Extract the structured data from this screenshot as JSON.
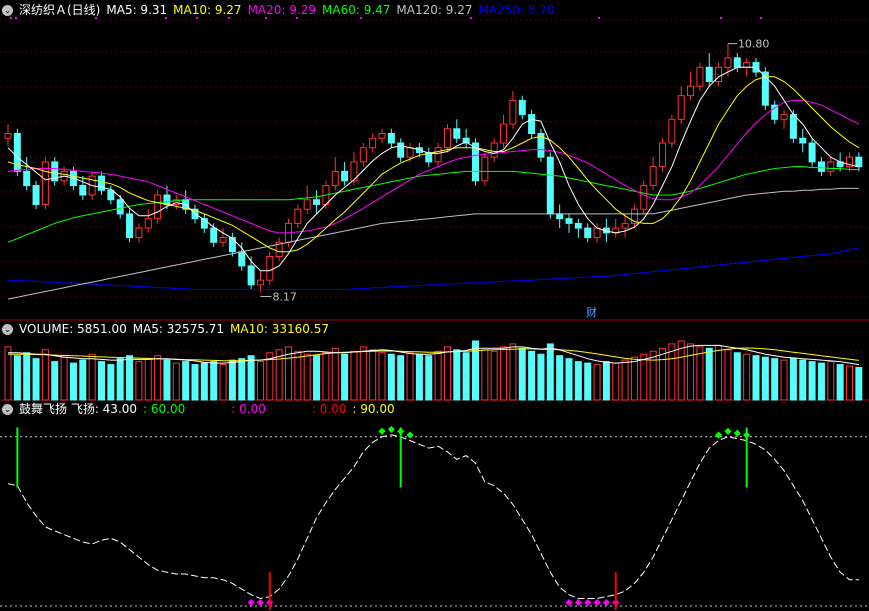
{
  "panels": {
    "price": {
      "title": "深纺织Ａ(日线)",
      "indicators": [
        {
          "label": "MA5: 9.31",
          "color": "#ffffff"
        },
        {
          "label": "MA10: 9.27",
          "color": "#ffff00"
        },
        {
          "label": "MA20: 9.29",
          "color": "#ff00ff"
        },
        {
          "label": "MA60: 9.47",
          "color": "#00ff00"
        },
        {
          "label": "MA120: 9.27",
          "color": "#c0c0c0"
        },
        {
          "label": "MA250: 8.70",
          "color": "#0000ff"
        }
      ],
      "high_label": "10.80",
      "low_label": "8.17",
      "marker": "财"
    },
    "volume": {
      "indicators": [
        {
          "label": "VOLUME: 5851.00",
          "color": "#ffffff"
        },
        {
          "label": "MA5: 32575.71",
          "color": "#ffffff"
        },
        {
          "label": "MA10: 33160.57",
          "color": "#ffff00"
        }
      ]
    },
    "oscillator": {
      "indicators": [
        {
          "label": "鼓舞飞扬  飞扬: 43.00",
          "color": "#ffffff"
        },
        {
          "label": ": 60.00",
          "color": "#00ff00"
        },
        {
          "label": ": 0.00",
          "color": "#ff00ff"
        },
        {
          "label": ": 0.00",
          "color": "#ff0000"
        },
        {
          "label": ": 90.00",
          "color": "#ffff00"
        }
      ]
    }
  },
  "colors": {
    "up": "#ff3232",
    "down": "#54fcfc",
    "ma5": "#ffffff",
    "ma10": "#ffff00",
    "ma20": "#ff00ff",
    "ma60": "#00ff00",
    "ma120": "#c0c0c0",
    "ma250": "#0000ff",
    "separator": "#aa0000"
  },
  "chart_data": {
    "type": "candlestick",
    "candles": [
      [
        9.8,
        9.85,
        9.72,
        9.95
      ],
      [
        9.85,
        9.45,
        9.4,
        9.9
      ],
      [
        9.45,
        9.3,
        9.25,
        9.6
      ],
      [
        9.3,
        9.1,
        9.05,
        9.35
      ],
      [
        9.1,
        9.55,
        9.05,
        9.6
      ],
      [
        9.55,
        9.35,
        9.3,
        9.6
      ],
      [
        9.35,
        9.45,
        9.3,
        9.5
      ],
      [
        9.45,
        9.3,
        9.25,
        9.5
      ],
      [
        9.3,
        9.2,
        9.15,
        9.4
      ],
      [
        9.2,
        9.4,
        9.15,
        9.45
      ],
      [
        9.4,
        9.25,
        9.2,
        9.45
      ],
      [
        9.25,
        9.15,
        9.1,
        9.3
      ],
      [
        9.15,
        9.0,
        8.95,
        9.2
      ],
      [
        9.0,
        8.75,
        8.7,
        9.05
      ],
      [
        8.75,
        8.85,
        8.7,
        8.9
      ],
      [
        8.85,
        8.95,
        8.8,
        9.05
      ],
      [
        8.95,
        9.2,
        8.9,
        9.25
      ],
      [
        9.2,
        9.1,
        9.05,
        9.3
      ],
      [
        9.1,
        9.15,
        9.05,
        9.2
      ],
      [
        9.15,
        9.05,
        9.0,
        9.25
      ],
      [
        9.05,
        8.95,
        8.9,
        9.1
      ],
      [
        8.95,
        8.85,
        8.8,
        9.0
      ],
      [
        8.85,
        8.7,
        8.65,
        8.9
      ],
      [
        8.7,
        8.75,
        8.65,
        8.85
      ],
      [
        8.75,
        8.6,
        8.55,
        8.8
      ],
      [
        8.6,
        8.45,
        8.4,
        8.7
      ],
      [
        8.45,
        8.25,
        8.2,
        8.55
      ],
      [
        8.25,
        8.3,
        8.17,
        8.4
      ],
      [
        8.3,
        8.55,
        8.25,
        8.6
      ],
      [
        8.55,
        8.7,
        8.5,
        8.75
      ],
      [
        8.7,
        8.9,
        8.65,
        8.95
      ],
      [
        8.9,
        9.05,
        8.85,
        9.1
      ],
      [
        9.05,
        9.15,
        9.0,
        9.3
      ],
      [
        9.15,
        9.1,
        9.0,
        9.25
      ],
      [
        9.1,
        9.3,
        9.05,
        9.35
      ],
      [
        9.3,
        9.45,
        9.25,
        9.6
      ],
      [
        9.45,
        9.35,
        9.3,
        9.55
      ],
      [
        9.35,
        9.55,
        9.3,
        9.65
      ],
      [
        9.55,
        9.7,
        9.5,
        9.75
      ],
      [
        9.7,
        9.8,
        9.65,
        9.85
      ],
      [
        9.8,
        9.85,
        9.75,
        9.9
      ],
      [
        9.85,
        9.75,
        9.7,
        9.9
      ],
      [
        9.75,
        9.6,
        9.55,
        9.8
      ],
      [
        9.6,
        9.7,
        9.55,
        9.75
      ],
      [
        9.7,
        9.65,
        9.6,
        9.75
      ],
      [
        9.65,
        9.55,
        9.5,
        9.7
      ],
      [
        9.55,
        9.7,
        9.5,
        9.75
      ],
      [
        9.7,
        9.9,
        9.65,
        9.95
      ],
      [
        9.9,
        9.8,
        9.75,
        10.0
      ],
      [
        9.8,
        9.75,
        9.7,
        9.9
      ],
      [
        9.75,
        9.35,
        9.3,
        9.8
      ],
      [
        9.35,
        9.6,
        9.3,
        9.65
      ],
      [
        9.6,
        9.75,
        9.55,
        9.8
      ],
      [
        9.75,
        9.95,
        9.7,
        10.05
      ],
      [
        9.95,
        10.2,
        9.9,
        10.3
      ],
      [
        10.2,
        10.05,
        10.0,
        10.25
      ],
      [
        10.05,
        9.85,
        9.8,
        10.1
      ],
      [
        9.85,
        9.6,
        9.55,
        9.9
      ],
      [
        9.6,
        9.0,
        8.95,
        9.65
      ],
      [
        9.0,
        8.95,
        8.85,
        9.1
      ],
      [
        8.95,
        8.9,
        8.8,
        9.0
      ],
      [
        8.9,
        8.85,
        8.75,
        8.95
      ],
      [
        8.85,
        8.75,
        8.7,
        8.9
      ],
      [
        8.75,
        8.85,
        8.7,
        8.9
      ],
      [
        8.85,
        8.8,
        8.7,
        8.95
      ],
      [
        8.8,
        8.85,
        8.75,
        8.95
      ],
      [
        8.85,
        8.9,
        8.75,
        9.0
      ],
      [
        8.9,
        9.05,
        8.85,
        9.1
      ],
      [
        9.05,
        9.3,
        9.0,
        9.35
      ],
      [
        9.3,
        9.5,
        9.25,
        9.6
      ],
      [
        9.5,
        9.75,
        9.45,
        9.8
      ],
      [
        9.75,
        10.0,
        9.7,
        10.05
      ],
      [
        10.0,
        10.25,
        9.95,
        10.35
      ],
      [
        10.25,
        10.35,
        10.2,
        10.5
      ],
      [
        10.35,
        10.55,
        10.3,
        10.6
      ],
      [
        10.55,
        10.4,
        10.35,
        10.7
      ],
      [
        10.4,
        10.55,
        10.35,
        10.6
      ],
      [
        10.55,
        10.65,
        10.45,
        10.8
      ],
      [
        10.65,
        10.55,
        10.5,
        10.7
      ],
      [
        10.55,
        10.6,
        10.45,
        10.65
      ],
      [
        10.6,
        10.5,
        10.45,
        10.65
      ],
      [
        10.5,
        10.15,
        10.1,
        10.55
      ],
      [
        10.15,
        10.0,
        9.95,
        10.2
      ],
      [
        10.0,
        10.05,
        9.9,
        10.1
      ],
      [
        10.05,
        9.8,
        9.75,
        10.1
      ],
      [
        9.8,
        9.75,
        9.65,
        9.9
      ],
      [
        9.75,
        9.55,
        9.5,
        9.8
      ],
      [
        9.55,
        9.45,
        9.4,
        9.6
      ],
      [
        9.45,
        9.55,
        9.4,
        9.6
      ],
      [
        9.55,
        9.5,
        9.45,
        9.65
      ],
      [
        9.5,
        9.6,
        9.45,
        9.65
      ],
      [
        9.6,
        9.5,
        9.45,
        9.65
      ]
    ],
    "ma5": [
      9.7,
      9.6,
      9.52,
      9.44,
      9.36,
      9.38,
      9.4,
      9.38,
      9.34,
      9.3,
      9.28,
      9.26,
      9.18,
      9.06,
      8.98,
      8.98,
      9.02,
      9.08,
      9.12,
      9.1,
      9.0,
      8.94,
      8.86,
      8.8,
      8.74,
      8.64,
      8.5,
      8.4,
      8.4,
      8.45,
      8.58,
      8.74,
      8.9,
      9.0,
      9.1,
      9.2,
      9.28,
      9.36,
      9.46,
      9.56,
      9.64,
      9.7,
      9.72,
      9.7,
      9.68,
      9.64,
      9.64,
      9.66,
      9.72,
      9.76,
      9.7,
      9.66,
      9.64,
      9.68,
      9.8,
      9.95,
      10.0,
      9.98,
      9.75,
      9.55,
      9.3,
      9.1,
      8.95,
      8.85,
      8.82,
      8.8,
      8.82,
      8.86,
      8.95,
      9.1,
      9.3,
      9.5,
      9.75,
      9.98,
      10.2,
      10.35,
      10.45,
      10.5,
      10.55,
      10.55,
      10.55,
      10.45,
      10.35,
      10.2,
      10.05,
      9.95,
      9.8,
      9.7,
      9.6,
      9.55,
      9.52,
      9.5
    ],
    "ma10": [
      9.55,
      9.52,
      9.5,
      9.48,
      9.45,
      9.43,
      9.42,
      9.4,
      9.38,
      9.36,
      9.34,
      9.32,
      9.28,
      9.22,
      9.18,
      9.14,
      9.12,
      9.1,
      9.08,
      9.06,
      9.04,
      9.0,
      8.96,
      8.92,
      8.88,
      8.82,
      8.76,
      8.7,
      8.64,
      8.6,
      8.6,
      8.62,
      8.68,
      8.76,
      8.85,
      8.94,
      9.02,
      9.12,
      9.22,
      9.32,
      9.42,
      9.48,
      9.54,
      9.58,
      9.62,
      9.64,
      9.66,
      9.68,
      9.7,
      9.7,
      9.7,
      9.68,
      9.66,
      9.66,
      9.7,
      9.75,
      9.8,
      9.82,
      9.78,
      9.7,
      9.6,
      9.48,
      9.36,
      9.25,
      9.15,
      9.05,
      8.98,
      8.92,
      8.9,
      8.9,
      8.95,
      9.05,
      9.18,
      9.35,
      9.55,
      9.75,
      9.95,
      10.1,
      10.25,
      10.35,
      10.42,
      10.45,
      10.45,
      10.4,
      10.32,
      10.22,
      10.12,
      10.02,
      9.92,
      9.84,
      9.76,
      9.7
    ],
    "ma20": [
      9.45,
      9.46,
      9.47,
      9.48,
      9.48,
      9.48,
      9.47,
      9.46,
      9.45,
      9.44,
      9.43,
      9.42,
      9.4,
      9.38,
      9.36,
      9.34,
      9.3,
      9.26,
      9.22,
      9.18,
      9.14,
      9.1,
      9.06,
      9.02,
      8.98,
      8.94,
      8.9,
      8.86,
      8.82,
      8.8,
      8.8,
      8.81,
      8.82,
      8.84,
      8.86,
      8.9,
      8.95,
      9.0,
      9.06,
      9.12,
      9.18,
      9.24,
      9.3,
      9.36,
      9.42,
      9.46,
      9.5,
      9.54,
      9.58,
      9.6,
      9.62,
      9.63,
      9.64,
      9.65,
      9.66,
      9.67,
      9.68,
      9.68,
      9.67,
      9.65,
      9.62,
      9.58,
      9.54,
      9.48,
      9.42,
      9.36,
      9.3,
      9.25,
      9.2,
      9.16,
      9.15,
      9.15,
      9.18,
      9.22,
      9.3,
      9.4,
      9.5,
      9.62,
      9.74,
      9.86,
      9.96,
      10.05,
      10.12,
      10.18,
      10.2,
      10.2,
      10.18,
      10.15,
      10.1,
      10.05,
      10.0,
      9.95
    ],
    "ma60": [
      8.7,
      8.74,
      8.78,
      8.82,
      8.86,
      8.9,
      8.93,
      8.96,
      8.98,
      9.0,
      9.02,
      9.04,
      9.06,
      9.08,
      9.1,
      9.11,
      9.12,
      9.13,
      9.14,
      9.15,
      9.15,
      9.15,
      9.15,
      9.15,
      9.15,
      9.15,
      9.15,
      9.15,
      9.15,
      9.15,
      9.15,
      9.16,
      9.17,
      9.18,
      9.2,
      9.22,
      9.24,
      9.26,
      9.28,
      9.3,
      9.32,
      9.34,
      9.36,
      9.38,
      9.4,
      9.41,
      9.42,
      9.43,
      9.44,
      9.45,
      9.45,
      9.45,
      9.45,
      9.45,
      9.45,
      9.44,
      9.43,
      9.42,
      9.41,
      9.4,
      9.38,
      9.36,
      9.34,
      9.32,
      9.3,
      9.28,
      9.26,
      9.24,
      9.22,
      9.2,
      9.2,
      9.2,
      9.22,
      9.24,
      9.27,
      9.3,
      9.33,
      9.36,
      9.39,
      9.42,
      9.44,
      9.46,
      9.48,
      9.49,
      9.5,
      9.5,
      9.49,
      9.49,
      9.48,
      9.48,
      9.47,
      9.47
    ],
    "ma120": [
      8.1,
      8.12,
      8.14,
      8.16,
      8.18,
      8.2,
      8.22,
      8.24,
      8.26,
      8.28,
      8.3,
      8.32,
      8.34,
      8.36,
      8.38,
      8.4,
      8.42,
      8.44,
      8.46,
      8.48,
      8.5,
      8.52,
      8.54,
      8.56,
      8.58,
      8.6,
      8.62,
      8.64,
      8.66,
      8.68,
      8.7,
      8.72,
      8.74,
      8.76,
      8.78,
      8.8,
      8.82,
      8.84,
      8.86,
      8.88,
      8.9,
      8.91,
      8.92,
      8.93,
      8.94,
      8.95,
      8.96,
      8.97,
      8.98,
      8.99,
      9.0,
      9.0,
      9.0,
      9.0,
      9.0,
      9.0,
      9.0,
      9.0,
      9.0,
      9.0,
      9.0,
      9.0,
      9.0,
      9.0,
      9.0,
      9.0,
      9.0,
      9.0,
      9.0,
      9.0,
      9.02,
      9.04,
      9.06,
      9.08,
      9.1,
      9.12,
      9.14,
      9.16,
      9.18,
      9.2,
      9.21,
      9.22,
      9.23,
      9.24,
      9.24,
      9.25,
      9.25,
      9.26,
      9.26,
      9.27,
      9.27,
      9.27
    ],
    "ma250": [
      8.3,
      8.3,
      8.29,
      8.29,
      8.28,
      8.28,
      8.27,
      8.27,
      8.26,
      8.26,
      8.25,
      8.25,
      8.24,
      8.24,
      8.23,
      8.23,
      8.22,
      8.22,
      8.21,
      8.21,
      8.2,
      8.2,
      8.2,
      8.2,
      8.2,
      8.2,
      8.2,
      8.2,
      8.2,
      8.2,
      8.2,
      8.2,
      8.2,
      8.2,
      8.2,
      8.2,
      8.2,
      8.21,
      8.21,
      8.22,
      8.22,
      8.23,
      8.23,
      8.24,
      8.24,
      8.25,
      8.25,
      8.26,
      8.26,
      8.27,
      8.27,
      8.28,
      8.28,
      8.29,
      8.29,
      8.3,
      8.3,
      8.31,
      8.31,
      8.32,
      8.32,
      8.33,
      8.33,
      8.34,
      8.34,
      8.35,
      8.36,
      8.37,
      8.38,
      8.39,
      8.4,
      8.41,
      8.42,
      8.43,
      8.44,
      8.45,
      8.46,
      8.47,
      8.48,
      8.49,
      8.5,
      8.51,
      8.52,
      8.53,
      8.54,
      8.55,
      8.56,
      8.57,
      8.58,
      8.6,
      8.62,
      8.64
    ],
    "volume": [
      36000,
      30000,
      32000,
      28000,
      34000,
      26000,
      30000,
      25000,
      27000,
      31000,
      26000,
      24000,
      28000,
      30000,
      26000,
      28000,
      30000,
      27000,
      25000,
      26000,
      24000,
      25000,
      26000,
      24000,
      27000,
      28000,
      30000,
      26000,
      32000,
      34000,
      36000,
      33000,
      31000,
      30000,
      32000,
      35000,
      31000,
      33000,
      36000,
      34000,
      32000,
      31000,
      30000,
      32000,
      31000,
      30000,
      33000,
      36000,
      34000,
      32000,
      40000,
      34000,
      33000,
      36000,
      38000,
      35000,
      33000,
      31000,
      38000,
      30000,
      28000,
      26000,
      25000,
      24000,
      26000,
      25000,
      27000,
      29000,
      31000,
      33000,
      35000,
      38000,
      40000,
      38000,
      36000,
      35000,
      37000,
      34000,
      32000,
      31000,
      30000,
      29000,
      28000,
      27000,
      28000,
      27000,
      26000,
      25000,
      26000,
      24000,
      23000,
      22000
    ],
    "vol_ma5": [
      32000,
      32000,
      31500,
      31000,
      31000,
      30000,
      29000,
      28500,
      28000,
      28000,
      27500,
      27000,
      27000,
      27500,
      27500,
      27500,
      28000,
      28000,
      27500,
      27000,
      26500,
      25500,
      25000,
      25000,
      25500,
      26000,
      27000,
      27000,
      28000,
      29500,
      31000,
      32000,
      33000,
      33000,
      32500,
      32000,
      32000,
      32500,
      33000,
      33500,
      34000,
      33500,
      32500,
      31500,
      31000,
      31000,
      31500,
      32500,
      33000,
      33500,
      35000,
      35000,
      35000,
      35000,
      36000,
      36000,
      35000,
      34500,
      35000,
      34000,
      32000,
      30000,
      28000,
      26500,
      25500,
      25000,
      25500,
      26000,
      27500,
      29000,
      31000,
      33000,
      35000,
      36500,
      37000,
      37000,
      37000,
      36000,
      35000,
      34000,
      32500,
      31000,
      30000,
      29000,
      28500,
      28000,
      27500,
      27000,
      26500,
      26000,
      25000,
      24000
    ],
    "vol_ma10": [
      31000,
      31000,
      31000,
      30800,
      30600,
      30400,
      30200,
      30000,
      29800,
      29500,
      29200,
      29000,
      28800,
      28600,
      28400,
      28200,
      28000,
      27800,
      27600,
      27400,
      27200,
      27000,
      26800,
      26600,
      26600,
      26600,
      26800,
      27000,
      27400,
      27800,
      28400,
      29000,
      29800,
      30600,
      31400,
      32000,
      32400,
      32600,
      32800,
      33000,
      33200,
      33200,
      33000,
      32800,
      32600,
      32400,
      32400,
      32600,
      32800,
      33000,
      33400,
      33800,
      34000,
      34200,
      34400,
      34600,
      34600,
      34400,
      34200,
      34000,
      33600,
      33000,
      32200,
      31200,
      30200,
      29200,
      28200,
      27600,
      27200,
      27000,
      27400,
      28000,
      29000,
      30200,
      31400,
      32600,
      33600,
      34400,
      35000,
      35200,
      35000,
      34600,
      34000,
      33200,
      32400,
      31600,
      30800,
      30000,
      29200,
      28400,
      27600,
      26800
    ],
    "osc": [
      65,
      64,
      55,
      48,
      42,
      40,
      38,
      36,
      34,
      33,
      35,
      36,
      34,
      30,
      26,
      22,
      19,
      18,
      17,
      17,
      16,
      15,
      15,
      14,
      12,
      9,
      6,
      4,
      5,
      9,
      16,
      25,
      36,
      47,
      55,
      62,
      68,
      74,
      82,
      87,
      90,
      91,
      90,
      88,
      86,
      84,
      85,
      82,
      78,
      80,
      76,
      66,
      64,
      60,
      54,
      46,
      38,
      28,
      18,
      10,
      6,
      4,
      4,
      4,
      5,
      6,
      8,
      12,
      18,
      26,
      36,
      46,
      56,
      66,
      76,
      84,
      88,
      90,
      89,
      88,
      86,
      83,
      78,
      72,
      64,
      56,
      46,
      36,
      26,
      18,
      14,
      14
    ]
  }
}
